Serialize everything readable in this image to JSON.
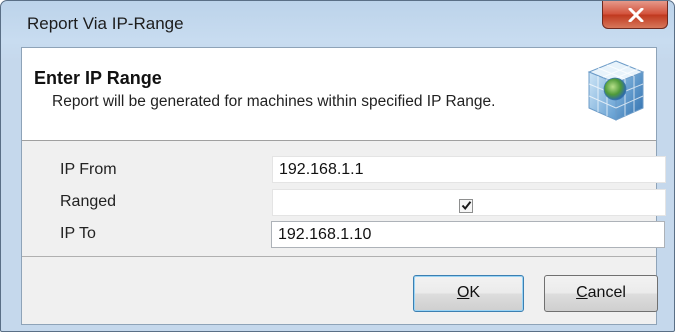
{
  "window": {
    "title": "Report Via IP-Range"
  },
  "header": {
    "title": "Enter IP Range",
    "description": "Report will be generated for machines within specified IP Range."
  },
  "fields": {
    "ip_from": {
      "label": "IP From",
      "value": "192.168.1.1"
    },
    "ranged": {
      "label": "Ranged",
      "checked": true
    },
    "ip_to": {
      "label": "IP To",
      "value": "192.168.1.10"
    }
  },
  "buttons": {
    "ok": {
      "mnemonic": "O",
      "rest": "K"
    },
    "cancel": {
      "mnemonic": "C",
      "rest": "ancel"
    }
  },
  "icons": {
    "close": "close-icon",
    "header": "network-cube-icon",
    "check": "checkmark-icon"
  },
  "colors": {
    "close_button": "#c94a30",
    "titlebar": "#c5d8ec",
    "dialog_bg": "#f0f0f0",
    "ok_border": "#3c7fb1"
  }
}
